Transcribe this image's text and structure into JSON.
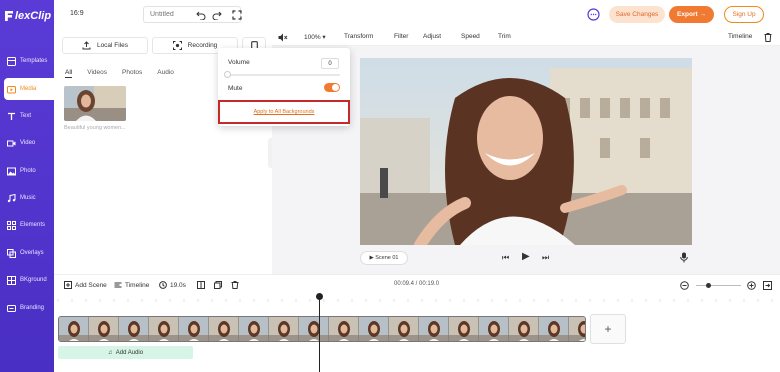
{
  "app": {
    "logo_text": "lexClip"
  },
  "sidebar": {
    "items": [
      {
        "label": "Templates"
      },
      {
        "label": "Media"
      },
      {
        "label": "Text"
      },
      {
        "label": "Video"
      },
      {
        "label": "Photo"
      },
      {
        "label": "Music"
      },
      {
        "label": "Elements"
      },
      {
        "label": "Overlays"
      },
      {
        "label": "BKground"
      },
      {
        "label": "Branding"
      }
    ]
  },
  "topbar": {
    "ratio": "16:9",
    "title_placeholder": "Untitled",
    "save_label": "Save Changes",
    "export_label": "Export →",
    "signup_label": "Sign Up"
  },
  "media_panel": {
    "local_files": "Local Files",
    "recording": "Recording",
    "tabs": [
      "All",
      "Videos",
      "Photos",
      "Audio"
    ],
    "thumb_caption": "Beautiful young women..."
  },
  "edit_bar": {
    "zoom": "100%",
    "transform": "Transform",
    "filter": "Filter",
    "adjust": "Adjust",
    "speed": "Speed",
    "trim": "Trim",
    "timeline": "Timeline"
  },
  "volume_popup": {
    "volume_label": "Volume",
    "volume_value": "0",
    "volume_level": 0,
    "mute_label": "Mute",
    "mute_on": true,
    "apply_all": "Apply to All Backgrounds"
  },
  "player": {
    "scene_label": "Scene  01"
  },
  "timeline_bar": {
    "add_scene": "Add Scene",
    "timeline": "Timeline",
    "duration": "19.0s",
    "timecode": "00:09.4 / 00:19.0"
  },
  "timeline": {
    "add_audio": "Add Audio"
  },
  "colors": {
    "accent": "#f17a32",
    "sidebar": "#5a3bd6",
    "highlight_border": "#c42a2a"
  }
}
